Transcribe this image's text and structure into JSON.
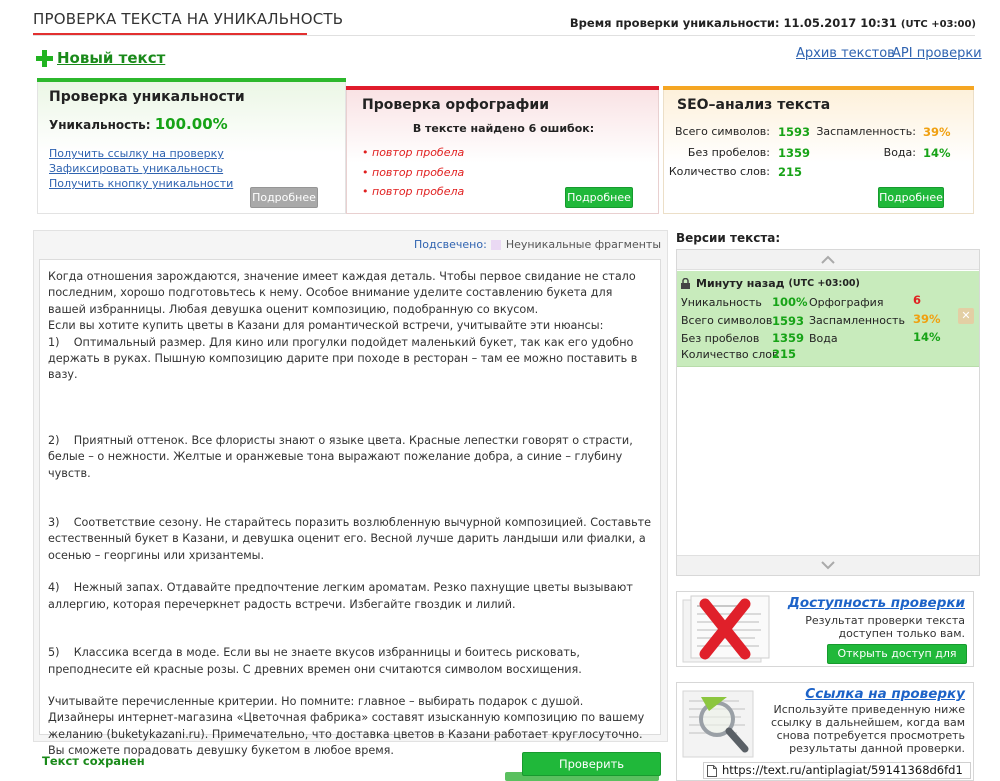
{
  "header": {
    "title": "ПРОВЕРКА ТЕКСТА НА УНИКАЛЬНОСТЬ",
    "check_time_label": "Время проверки уникальности: 11.05.2017 10:31",
    "check_time_tz": "(UTC +03:00)",
    "new_text": "Новый текст",
    "archive_link": "Архив текстов",
    "api_link": "API проверки"
  },
  "uniqueness": {
    "title": "Проверка уникальности",
    "label": "Уникальность:",
    "value": "100.00%",
    "links": [
      "Получить ссылку на проверку",
      "Зафиксировать уникальность",
      "Получить кнопку уникальности"
    ],
    "more_button": "Подробнее"
  },
  "spelling": {
    "title": "Проверка орфографии",
    "summary": "В тексте найдено 6 ошибок:",
    "errors": [
      "повтор пробела",
      "повтор пробела",
      "повтор пробела"
    ],
    "more_button": "Подробнее"
  },
  "seo": {
    "title": "SEO–анализ текста",
    "total_chars_label": "Всего символов:",
    "total_chars": "1593",
    "no_spaces_label": "Без пробелов:",
    "no_spaces": "1359",
    "words_label": "Количество слов:",
    "words": "215",
    "spam_label": "Заспамленность:",
    "spam": "39%",
    "water_label": "Вода:",
    "water": "14%",
    "more_button": "Подробнее"
  },
  "text_area": {
    "highlight_label": "Подсвечено:",
    "highlight_legend": "Неуникальные фрагменты",
    "paragraphs": [
      "Когда отношения зарождаются, значение имеет каждая деталь. Чтобы первое свидание не стало последним, хорошо подготовьтесь к нему. Особое внимание уделите составлению букета для вашей избранницы. Любая девушка оценит композицию, подобранную со вкусом.",
      "Если вы хотите купить цветы в Казани для романтической встречи, учитывайте эти нюансы:",
      "1)    Оптимальный размер. Для кино или прогулки подойдет маленький букет, так как его удобно держать в руках. Пышную композицию дарите при походе в ресторан – там ее можно поставить в вазу.",
      "2)    Приятный оттенок. Все флористы знают о языке цвета. Красные лепестки говорят о страсти, белые – о нежности. Желтые и оранжевые тона выражают пожелание добра, а синие – глубину чувств.",
      "3)    Соответствие сезону. Не старайтесь поразить возлюбленную вычурной композицией. Составьте естественный букет в Казани, и девушка оценит его. Весной лучше дарить ландыши или фиалки, а осенью – георгины или хризантемы.",
      "4)    Нежный запах. Отдавайте предпочтение легким ароматам. Резко пахнущие цветы вызывают аллергию, которая перечеркнет радость встречи. Избегайте гвоздик и лилий.",
      "5)    Классика всегда в моде. Если вы не знаете вкусов избранницы и боитесь рисковать, преподнесите ей красные розы. С древних времен они считаются символом восхищения.",
      "Учитывайте перечисленные критерии. Но помните: главное – выбирать подарок с душой. Дизайнеры интернет-магазина «Цветочная фабрика» составят изысканную композицию по вашему желанию (buketykazani.ru). Примечательно, что доставка цветов в Казани работает круглосуточно. Вы сможете порадовать девушку букетом в любое время."
    ],
    "saved_status": "Текст сохранен",
    "check_button": "Проверить уникальность"
  },
  "versions": {
    "title": "Версии текста:",
    "item": {
      "time": "Минуту назад",
      "tz": "(UTC +03:00)",
      "uniq_label": "Уникальность",
      "uniq": "100%",
      "spelling_label": "Орфография",
      "spelling": "6",
      "total_label": "Всего символов",
      "total": "1593",
      "spam_label": "Заспамленность",
      "spam": "39%",
      "nospace_label": "Без пробелов",
      "nospace": "1359",
      "water_label": "Вода",
      "water": "14%",
      "words_label": "Количество слов",
      "words": "215"
    }
  },
  "promo_access": {
    "title": "Доступность проверки",
    "desc": "Результат проверки текста доступен только вам.",
    "button": "Открыть доступ для всех"
  },
  "promo_link": {
    "title": "Ссылка на проверку",
    "desc": "Используйте приведенную ниже ссылку в дальнейшем, когда вам снова потребуется просмотреть результаты данной проверки.",
    "url": "https://text.ru/antiplagiat/59141368d6fd1"
  },
  "colors": {
    "green": "#20b83a",
    "red": "#e01c2c",
    "orange": "#f5a623",
    "link": "#2f63b0"
  }
}
